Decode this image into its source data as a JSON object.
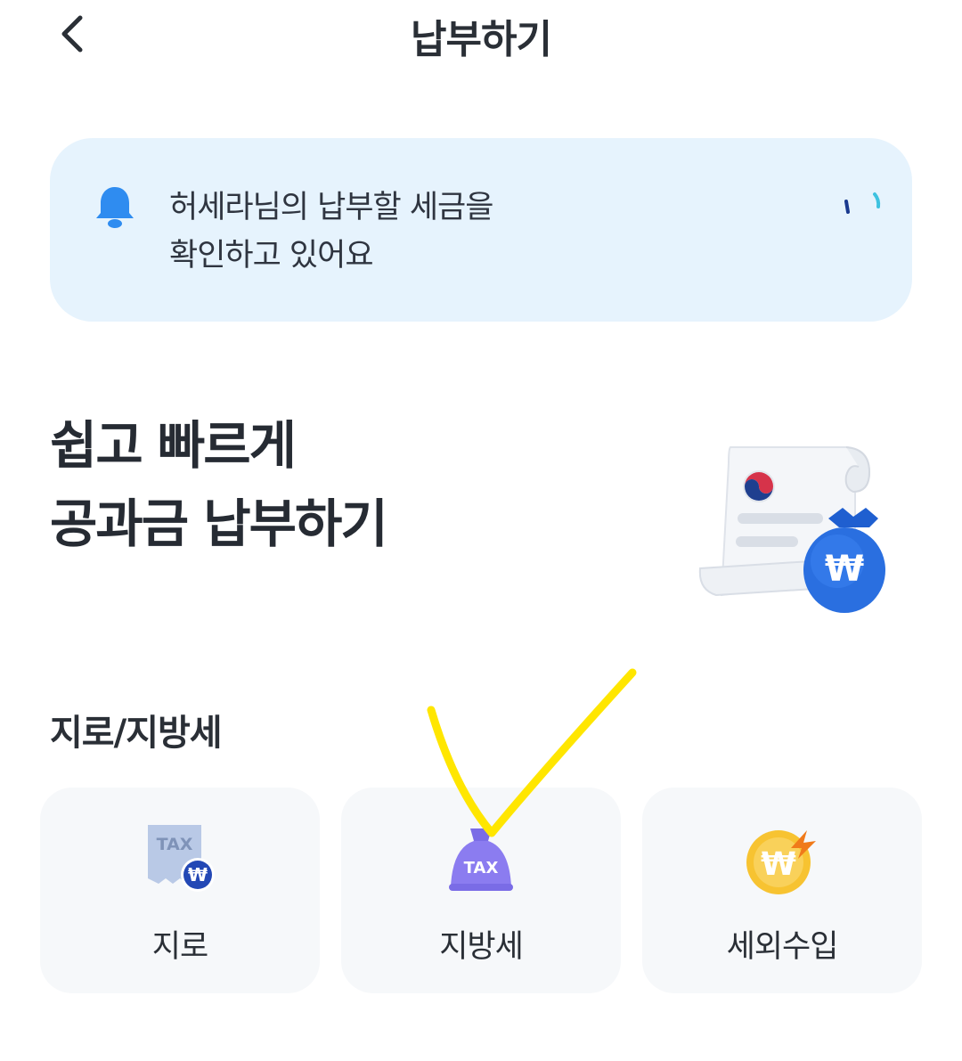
{
  "header": {
    "title": "납부하기",
    "back_icon": "chevron-left-icon"
  },
  "notice": {
    "icon": "bell-icon",
    "line1": "허세라님의 납부할 세금을",
    "line2": "확인하고 있어요",
    "accent_color": "#2f8cf0",
    "background": "#e6f3fd"
  },
  "hero": {
    "line1": "쉽고 빠르게",
    "line2": "공과금 납부하기",
    "illustration": "tax-bill-with-money-bag-icon"
  },
  "section": {
    "title": "지로/지방세"
  },
  "cards": [
    {
      "label": "지로",
      "icon": "giro-receipt-icon"
    },
    {
      "label": "지방세",
      "icon": "local-tax-bag-icon"
    },
    {
      "label": "세외수입",
      "icon": "non-tax-revenue-coin-icon"
    }
  ],
  "icon_text": {
    "tax": "TAX",
    "won": "₩"
  },
  "colors": {
    "annotation": "#ffe600",
    "local_tax_bag": "#8b7cf0",
    "non_tax_coin": "#f7c331"
  }
}
